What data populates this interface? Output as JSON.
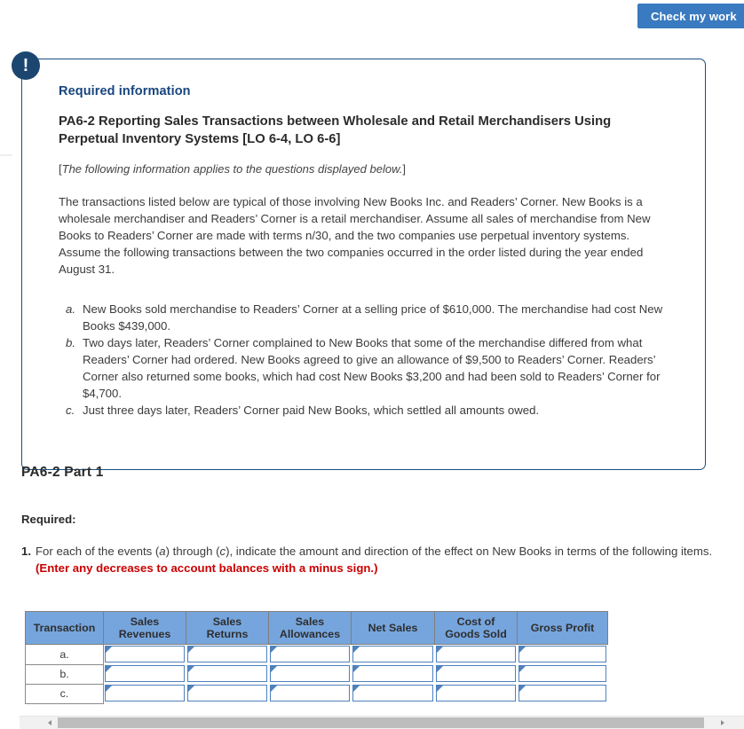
{
  "toolbar": {
    "check_my_work_label": "Check my work"
  },
  "info_card": {
    "alert_icon": "exclamation-icon",
    "alert_glyph": "!",
    "section_label": "Required information",
    "problem_title": "PA6-2 Reporting Sales Transactions between Wholesale and Retail Merchandisers Using Perpetual Inventory Systems [LO 6-4, LO 6-6]",
    "bracket_note_open": "[",
    "bracket_note_italic": "The following information applies to the questions displayed below.",
    "bracket_note_close": "]",
    "intro_paragraph": "The transactions listed below are typical of those involving New Books Inc. and Readers’ Corner. New Books is a wholesale merchandiser and Readers’ Corner is a retail merchandiser. Assume all sales of merchandise from New Books to Readers’ Corner are made with terms n/30, and the two companies use perpetual inventory systems. Assume the following transactions between the two companies occurred in the order listed during the year ended August 31.",
    "events": [
      {
        "letter": "a.",
        "text": "New Books sold merchandise to Readers’ Corner at a selling price of $610,000. The merchandise had cost New Books $439,000."
      },
      {
        "letter": "b.",
        "text": "Two days later, Readers’ Corner complained to New Books that some of the merchandise differed from what Readers’ Corner had ordered. New Books agreed to give an allowance of $9,500 to Readers’ Corner. Readers’ Corner also returned some books, which had cost New Books $3,200 and had been sold to Readers’ Corner for $4,700."
      },
      {
        "letter": "c.",
        "text": "Just three days later, Readers’ Corner paid New Books, which settled all amounts owed."
      }
    ]
  },
  "part": {
    "title": "PA6-2 Part 1",
    "required_label": "Required:",
    "requirement": {
      "number": "1.",
      "text_before": "For each of the events (",
      "italic_a": "a",
      "text_mid1": ") through (",
      "italic_c": "c",
      "text_mid2": "), indicate the amount and direction of the effect on New Books in terms of the following items. ",
      "warning": "(Enter any decreases to account balances with a minus sign.)"
    }
  },
  "answer_table": {
    "headers": [
      "Transaction",
      "Sales Revenues",
      "Sales Returns",
      "Sales Allowances",
      "Net Sales",
      "Cost of Goods Sold",
      "Gross Profit"
    ],
    "headers_lines": [
      [
        "Transaction"
      ],
      [
        "Sales",
        "Revenues"
      ],
      [
        "Sales",
        "Returns"
      ],
      [
        "Sales",
        "Allowances"
      ],
      [
        "Net Sales"
      ],
      [
        "Cost of",
        "Goods Sold"
      ],
      [
        "Gross Profit"
      ]
    ],
    "rows": [
      {
        "label": "a.",
        "values": [
          "",
          "",
          "",
          "",
          "",
          ""
        ]
      },
      {
        "label": "b.",
        "values": [
          "",
          "",
          "",
          "",
          "",
          ""
        ]
      },
      {
        "label": "c.",
        "values": [
          "",
          "",
          "",
          "",
          "",
          ""
        ]
      }
    ],
    "header_bg": "#76a5dd",
    "cell_border": "#4f81bd"
  },
  "scrollbar": {
    "orientation": "horizontal",
    "left_arrow": "scroll-left-arrow",
    "right_arrow": "scroll-right-arrow"
  },
  "colors": {
    "accent_blue": "#3a7ac0",
    "card_border": "#1a4f82",
    "heading_navy": "#17457f",
    "warning_red": "#cc0000",
    "badge_navy": "#1b4670"
  }
}
